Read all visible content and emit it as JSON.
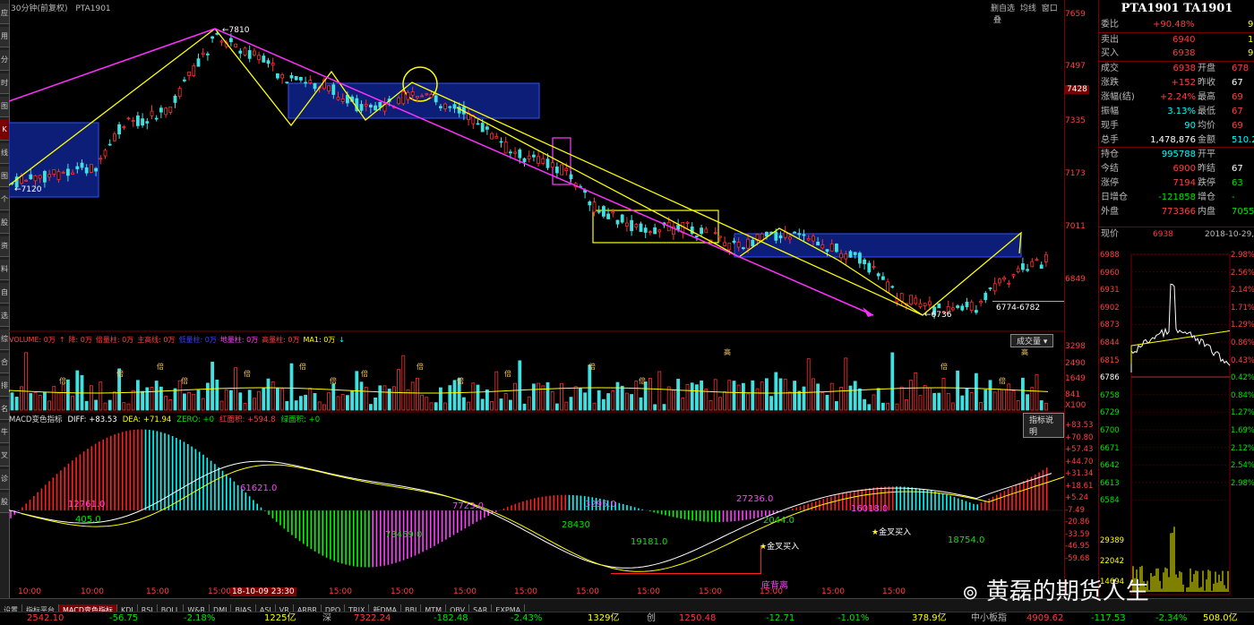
{
  "left_tabs": [
    "应",
    "用",
    "分",
    "时",
    "图",
    "K",
    "线",
    "图",
    "个",
    "股",
    "资",
    "料",
    "自",
    "选",
    "综",
    "合",
    "排",
    "名",
    "牛",
    "叉",
    "诊",
    "股"
  ],
  "main_header": {
    "period": "30分钟(前复权)",
    "symbol": "PTA1901",
    "right_buttons": [
      "删自选",
      "均线",
      "窗口",
      "叠"
    ]
  },
  "price_axis": {
    "ticks": [
      "7659",
      "7497",
      "7428",
      "7335",
      "7173",
      "7011",
      "6849"
    ],
    "current": "7428"
  },
  "volume_axis": {
    "ticks": [
      "3298",
      "2490",
      "1649",
      "841",
      "X100"
    ]
  },
  "macd_axis": {
    "ticks": [
      "+83.53",
      "+70.80",
      "+57.43",
      "+44.70",
      "+31.34",
      "+18.61",
      "+5.24",
      "-7.49",
      "-20.86",
      "-33.59",
      "-46.95",
      "-59.68"
    ]
  },
  "annotations": {
    "high": "7810",
    "low_left": "7120",
    "low_right": "6736",
    "range": "6774-6782"
  },
  "volume_header": [
    {
      "text": "VOLUME: 0万",
      "color": "#ff4040"
    },
    {
      "text": "↑",
      "color": "#ff4040"
    },
    {
      "text": "降: 0万",
      "color": "#ff4040"
    },
    {
      "text": "倍量柱: 0万",
      "color": "#ff4040"
    },
    {
      "text": "主高线: 0万",
      "color": "#ff4040"
    },
    {
      "text": "低量柱: 0万",
      "color": "#4040ff"
    },
    {
      "text": "地量柱: 0万",
      "color": "#ff40ff"
    },
    {
      "text": "高量柱: 0万",
      "color": "#ff4040"
    },
    {
      "text": "MA1: 0万",
      "color": "#ffff00"
    },
    {
      "text": "↓",
      "color": "#00ffff"
    }
  ],
  "volume_select": "成交量",
  "volume_marks": {
    "double": "倍",
    "high": "高"
  },
  "macd_header": [
    {
      "text": "MACD变色指标",
      "color": "#dddddd"
    },
    {
      "text": "DIFF: +83.53",
      "color": "#ffffff"
    },
    {
      "text": "DEA: +71.94",
      "color": "#ffff00"
    },
    {
      "text": "ZERO: +0",
      "color": "#00e600"
    },
    {
      "text": "红面积: +594.8",
      "color": "#ff4040"
    },
    {
      "text": "绿面积: +0",
      "color": "#00e600"
    }
  ],
  "macd_button": "指标说明",
  "macd_labels": {
    "a": "12761.0",
    "b": "405.0",
    "c": "61621.0",
    "d": "73459.0",
    "e": "7723.0",
    "f": "28430",
    "g": "3295.0",
    "h": "19181.0",
    "i": "27236.0",
    "j": "2044.0",
    "k": "16018.0",
    "l": "18754.0",
    "buy1": "金叉买入",
    "buy2": "金叉买入",
    "divergence": "底背离"
  },
  "time_axis": [
    "10:00",
    "10:00",
    "15:00",
    "15:00",
    "18-10-09 23:30",
    "15:00",
    "15:00",
    "15:00",
    "15:00",
    "15:00",
    "15:00",
    "15:00",
    "15:00",
    "15:00",
    "15:00"
  ],
  "bottom_tabs": [
    "设置",
    "指标平台",
    "MACD变色指标",
    "KDJ",
    "RSI",
    "BOLL",
    "W&R",
    "DMI",
    "BIAS",
    "ASI",
    "VR",
    "ARBR",
    "DPO",
    "TRIX",
    "新DMA",
    "BBI",
    "MTM",
    "OBV",
    "SAR",
    "EXPMA"
  ],
  "index_bar": {
    "a1": "2542.10",
    "a2": "-56.75",
    "a3": "-2.18%",
    "a4": "1225亿",
    "b_label": "深",
    "b1": "7322.24",
    "b2": "-182.48",
    "b3": "-2.43%",
    "b4": "1329亿",
    "c_label": "创",
    "c1": "1250.48",
    "c2": "-12.71",
    "c3": "-1.01%",
    "c4": "378.9亿",
    "d_label": "中小板指",
    "d1": "4909.62",
    "d2": "-117.53",
    "d3": "-2.34%",
    "d4": "508.0亿"
  },
  "right": {
    "title": "PTA1901 TA1901",
    "wei": {
      "label": "委比",
      "value": "+90.48%",
      "extra": "9"
    },
    "sell": {
      "label": "卖出",
      "value": "6940",
      "extra": "1"
    },
    "buy": {
      "label": "买入",
      "value": "6938",
      "extra": "9"
    },
    "rows": [
      {
        "l1": "成交",
        "v1": "6938",
        "l2": "开盘",
        "v2": "678",
        "c1": "#ff4040",
        "c2": "#ff4040"
      },
      {
        "l1": "涨跌",
        "v1": "+152",
        "l2": "昨收",
        "v2": "67",
        "c1": "#ff4040",
        "c2": "#ffffff"
      },
      {
        "l1": "涨幅(结)",
        "v1": "+2.24%",
        "l2": "最高",
        "v2": "69",
        "c1": "#ff4040",
        "c2": "#ff4040"
      },
      {
        "l1": "振幅",
        "v1": "3.13%",
        "l2": "最低",
        "v2": "67",
        "c1": "#00ffff",
        "c2": "#ff4040"
      },
      {
        "l1": "现手",
        "v1": "90",
        "l2": "均价",
        "v2": "69",
        "c1": "#00ffff",
        "c2": "#ff4040"
      },
      {
        "l1": "总手",
        "v1": "1,478,876",
        "l2": "金额",
        "v2": "510.2",
        "c1": "#ffffff",
        "c2": "#00ffff"
      }
    ],
    "rows2": [
      {
        "l1": "持仓",
        "v1": "995788",
        "l2": "开平",
        "v2": "",
        "c1": "#00ffff",
        "c2": "#ffffff"
      },
      {
        "l1": "今结",
        "v1": "6900",
        "l2": "昨结",
        "v2": "67",
        "c1": "#ff4040",
        "c2": "#ffffff"
      },
      {
        "l1": "涨停",
        "v1": "7194",
        "l2": "跌停",
        "v2": "63",
        "c1": "#ff4040",
        "c2": "#00e600"
      },
      {
        "l1": "日增仓",
        "v1": "-121858",
        "l2": "增仓",
        "v2": "-",
        "c1": "#00e600",
        "c2": "#00e600"
      },
      {
        "l1": "外盘",
        "v1": "773366",
        "l2": "内盘",
        "v2": "70557",
        "c1": "#ff4040",
        "c2": "#00e600"
      }
    ],
    "now": {
      "label": "现价",
      "value": "6938",
      "date": "2018-10-29,"
    },
    "mini_left": [
      "6988",
      "6960",
      "6931",
      "6902",
      "6873",
      "6844",
      "6815",
      "6786",
      "6758",
      "6729",
      "6700",
      "6671",
      "6642",
      "6613",
      "6584"
    ],
    "mini_right": [
      "2.98%",
      "2.56%",
      "2.14%",
      "1.71%",
      "1.29%",
      "0.86%",
      "0.43%",
      "0.42%",
      "0.84%",
      "1.27%",
      "1.69%",
      "2.12%",
      "2.54%",
      "2.98%"
    ],
    "mini_vol": [
      "29389",
      "22042",
      "14694"
    ]
  },
  "watermark": "黄磊的期货人生"
}
